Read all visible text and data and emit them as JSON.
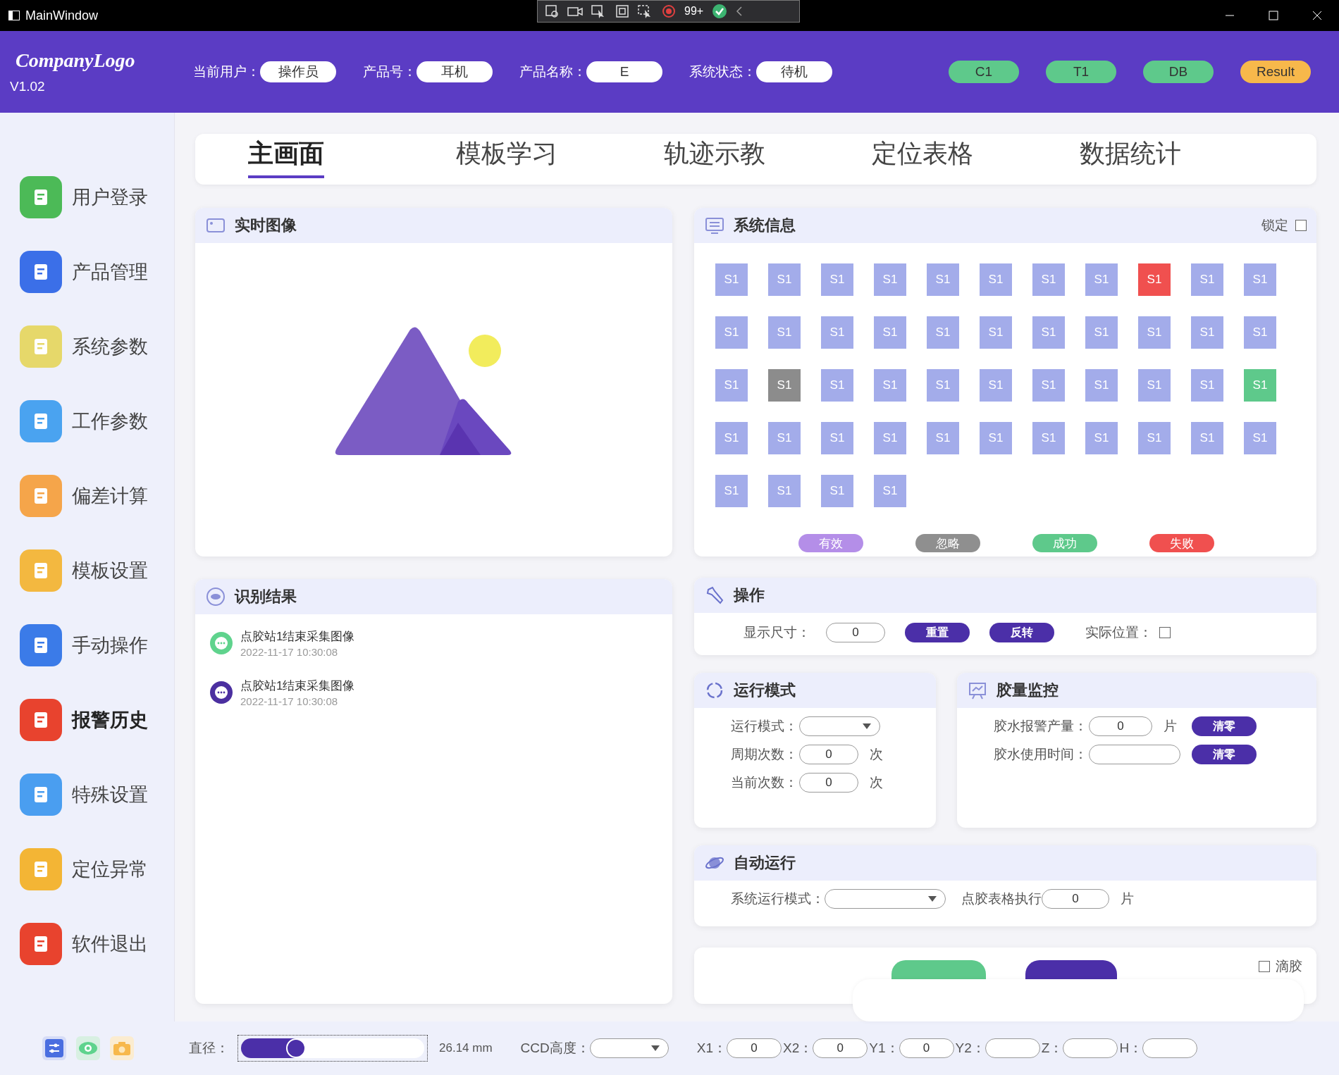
{
  "window": {
    "title": "MainWindow"
  },
  "debug_toolbar": {
    "badge": "99+"
  },
  "header": {
    "logo": "CompanyLogo",
    "version": "V1.02",
    "fields": [
      {
        "label": "当前用户：",
        "value": "操作员"
      },
      {
        "label": "产品号：",
        "value": "耳机"
      },
      {
        "label": "产品名称：",
        "value": "E"
      },
      {
        "label": "系统状态：",
        "value": "待机"
      }
    ],
    "badges": [
      {
        "label": "C1",
        "color": "#5ec98b"
      },
      {
        "label": "T1",
        "color": "#5ec98b"
      },
      {
        "label": "DB",
        "color": "#5ec98b"
      },
      {
        "label": "Result",
        "color": "#f7b84b"
      }
    ]
  },
  "sidebar": {
    "items": [
      {
        "label": "用户登录",
        "color": "#4cba57",
        "selected": false
      },
      {
        "label": "产品管理",
        "color": "#3b6fe8",
        "selected": false
      },
      {
        "label": "系统参数",
        "color": "#e6d86a",
        "selected": false
      },
      {
        "label": "工作参数",
        "color": "#4aa3f0",
        "selected": false
      },
      {
        "label": "偏差计算",
        "color": "#f5a54a",
        "selected": false
      },
      {
        "label": "模板设置",
        "color": "#f3b840",
        "selected": false
      },
      {
        "label": "手动操作",
        "color": "#3b7be8",
        "selected": false
      },
      {
        "label": "报警历史",
        "color": "#e8432e",
        "selected": true
      },
      {
        "label": "特殊设置",
        "color": "#4a9ef0",
        "selected": false
      },
      {
        "label": "定位异常",
        "color": "#f3b535",
        "selected": false
      },
      {
        "label": "软件退出",
        "color": "#e8432e",
        "selected": false
      }
    ]
  },
  "tabs": [
    {
      "label": "主画面",
      "selected": true
    },
    {
      "label": "模板学习",
      "selected": false
    },
    {
      "label": "轨迹示教",
      "selected": false
    },
    {
      "label": "定位表格",
      "selected": false
    },
    {
      "label": "数据统计",
      "selected": false
    }
  ],
  "live_image": {
    "title": "实时图像"
  },
  "recognition": {
    "title": "识别结果",
    "messages": [
      {
        "text": "点胶站1结束采集图像",
        "time": "2022-11-17 10:30:08",
        "color": "#5fd38d"
      },
      {
        "text": "点胶站1结束采集图像",
        "time": "2022-11-17 10:30:08",
        "color": "#4b2fa0"
      }
    ]
  },
  "system_info": {
    "title": "系统信息",
    "lock_label": "锁定",
    "locked": false,
    "stations": [
      {
        "label": "S1",
        "color": "#a3acea"
      },
      {
        "label": "S1",
        "color": "#a3acea"
      },
      {
        "label": "S1",
        "color": "#a3acea"
      },
      {
        "label": "S1",
        "color": "#a3acea"
      },
      {
        "label": "S1",
        "color": "#a3acea"
      },
      {
        "label": "S1",
        "color": "#a3acea"
      },
      {
        "label": "S1",
        "color": "#a3acea"
      },
      {
        "label": "S1",
        "color": "#a3acea"
      },
      {
        "label": "S1",
        "color": "#f0504f"
      },
      {
        "label": "S1",
        "color": "#a3acea"
      },
      {
        "label": "S1",
        "color": "#a3acea"
      },
      {
        "label": "S1",
        "color": "#a3acea"
      },
      {
        "label": "S1",
        "color": "#a3acea"
      },
      {
        "label": "S1",
        "color": "#a3acea"
      },
      {
        "label": "S1",
        "color": "#a3acea"
      },
      {
        "label": "S1",
        "color": "#a3acea"
      },
      {
        "label": "S1",
        "color": "#a3acea"
      },
      {
        "label": "S1",
        "color": "#a3acea"
      },
      {
        "label": "S1",
        "color": "#a3acea"
      },
      {
        "label": "S1",
        "color": "#a3acea"
      },
      {
        "label": "S1",
        "color": "#a3acea"
      },
      {
        "label": "S1",
        "color": "#a3acea"
      },
      {
        "label": "S1",
        "color": "#a3acea"
      },
      {
        "label": "S1",
        "color": "#8c8c8c"
      },
      {
        "label": "S1",
        "color": "#a3acea"
      },
      {
        "label": "S1",
        "color": "#a3acea"
      },
      {
        "label": "S1",
        "color": "#a3acea"
      },
      {
        "label": "S1",
        "color": "#a3acea"
      },
      {
        "label": "S1",
        "color": "#a3acea"
      },
      {
        "label": "S1",
        "color": "#a3acea"
      },
      {
        "label": "S1",
        "color": "#a3acea"
      },
      {
        "label": "S1",
        "color": "#a3acea"
      },
      {
        "label": "S1",
        "color": "#5ec98b"
      },
      {
        "label": "S1",
        "color": "#a3acea"
      },
      {
        "label": "S1",
        "color": "#a3acea"
      },
      {
        "label": "S1",
        "color": "#a3acea"
      },
      {
        "label": "S1",
        "color": "#a3acea"
      },
      {
        "label": "S1",
        "color": "#a3acea"
      },
      {
        "label": "S1",
        "color": "#a3acea"
      },
      {
        "label": "S1",
        "color": "#a3acea"
      },
      {
        "label": "S1",
        "color": "#a3acea"
      },
      {
        "label": "S1",
        "color": "#a3acea"
      },
      {
        "label": "S1",
        "color": "#a3acea"
      },
      {
        "label": "S1",
        "color": "#a3acea"
      },
      {
        "label": "S1",
        "color": "#a3acea"
      },
      {
        "label": "S1",
        "color": "#a3acea"
      },
      {
        "label": "S1",
        "color": "#a3acea"
      },
      {
        "label": "S1",
        "color": "#a3acea"
      }
    ],
    "legend": [
      {
        "label": "有效",
        "color": "#b48ee8"
      },
      {
        "label": "忽略",
        "color": "#8f8f8f"
      },
      {
        "label": "成功",
        "color": "#5ec98b"
      },
      {
        "label": "失败",
        "color": "#f0504f"
      }
    ]
  },
  "operation": {
    "title": "操作",
    "size_label": "显示尺寸：",
    "size_value": "0",
    "buttons": [
      "重置",
      "反转"
    ],
    "actual_label": "实际位置：",
    "actual_checked": false
  },
  "run_mode": {
    "title": "运行模式",
    "rows": [
      {
        "kind": "select",
        "label": "运行模式："
      },
      {
        "kind": "number",
        "label": "周期次数：",
        "value": "0",
        "unit": "次"
      },
      {
        "kind": "number",
        "label": "当前次数：",
        "value": "0",
        "unit": "次"
      }
    ]
  },
  "glue_monitor": {
    "title": "胶量监控",
    "rows": [
      {
        "label": "胶水报警产量：",
        "value": "0",
        "unit": "片",
        "button": "清零"
      },
      {
        "label": "胶水使用时间：",
        "button": "清零"
      }
    ]
  },
  "auto_run": {
    "title": "自动运行",
    "mode_label": "系统运行模式：",
    "table_label": "点胶表格执行",
    "table_value": "0",
    "table_unit": "片"
  },
  "actions": {
    "glue_label": "滴胶",
    "glue_checked": false
  },
  "status_bar": {
    "diameter_label": "直径：",
    "level": 0.3,
    "reading": "26.14 mm",
    "ccd_label": "CCD高度：",
    "coords": [
      {
        "label": "X1：",
        "value": "0"
      },
      {
        "label": "X2：",
        "value": "0"
      },
      {
        "label": "Y1：",
        "value": "0"
      },
      {
        "label": "Y2："
      },
      {
        "label": "Z："
      },
      {
        "label": "H："
      }
    ]
  }
}
